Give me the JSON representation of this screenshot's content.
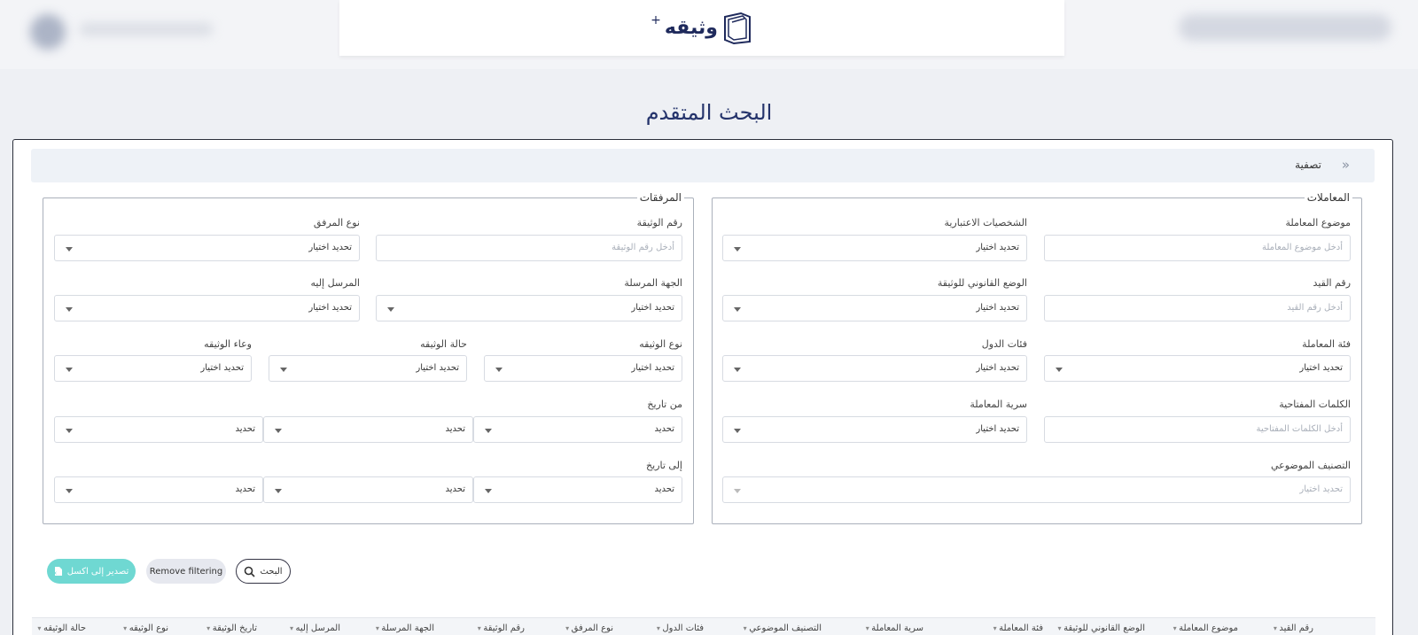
{
  "header": {
    "logo_text": "وثيقه",
    "logo_plus": "+"
  },
  "page_title": "البحث المتقدم",
  "filter": {
    "title": "تصفية"
  },
  "transactions": {
    "legend": "المعاملات",
    "subject_label": "موضوع المعاملة",
    "subject_placeholder": "أدخل موضوع المعاملة",
    "persons_label": "الشخصيات الاعتبارية",
    "persons_value": "تحديد اختيار",
    "record_label": "رقم القيد",
    "record_placeholder": "أدخل رقم القيد",
    "legal_label": "الوضع القانوني للوثيقة",
    "legal_value": "تحديد اختيار",
    "category_label": "فئة المعاملة",
    "category_value": "تحديد اختيار",
    "countries_label": "فئات الدول",
    "countries_value": "تحديد اختيار",
    "keywords_label": "الكلمات المفتاحية",
    "keywords_placeholder": "أدخل الكلمات المفتاحية",
    "secrecy_label": "سرية المعاملة",
    "secrecy_value": "تحديد اختيار",
    "topic_label": "التصنيف الموضوعي",
    "topic_placeholder": "تحديد اختيار"
  },
  "attachments": {
    "legend": "المرفقات",
    "doc_number_label": "رقم الوثيقة",
    "doc_number_placeholder": "أدخل رقم الوثيقة",
    "attach_type_label": "نوع المرفق",
    "attach_type_value": "تحديد اختيار",
    "sender_label": "الجهة المرسلة",
    "sender_value": "تحديد اختيار",
    "recipient_label": "المرسل إليه",
    "recipient_value": "تحديد اختيار",
    "doc_type_label": "نوع الوثيقه",
    "doc_type_value": "تحديد اختيار",
    "doc_status_label": "حالة الوثيقه",
    "doc_status_value": "تحديد اختيار",
    "container_label": "وعاء الوثيقه",
    "container_value": "تحديد اختيار",
    "from_date_label": "من تاريخ",
    "to_date_label": "إلى تاريخ",
    "date_value": "تحديد"
  },
  "buttons": {
    "search": "البحث",
    "remove": "Remove filtering",
    "export": "تصدير إلى اكسل"
  },
  "table_headers": [
    "رقم القيد",
    "موضوع المعاملة",
    "الوضع القانوني للوثيقة",
    "فئة المعاملة",
    "سرية المعاملة",
    "التصنيف الموضوعي",
    "فئات الدول",
    "نوع المرفق",
    "رقم الوثيقة",
    "الجهة المرسلة",
    "المرسل إليه",
    "تاريخ الوثيقة",
    "نوع الوثيقه",
    "حالة الوثيقه"
  ]
}
